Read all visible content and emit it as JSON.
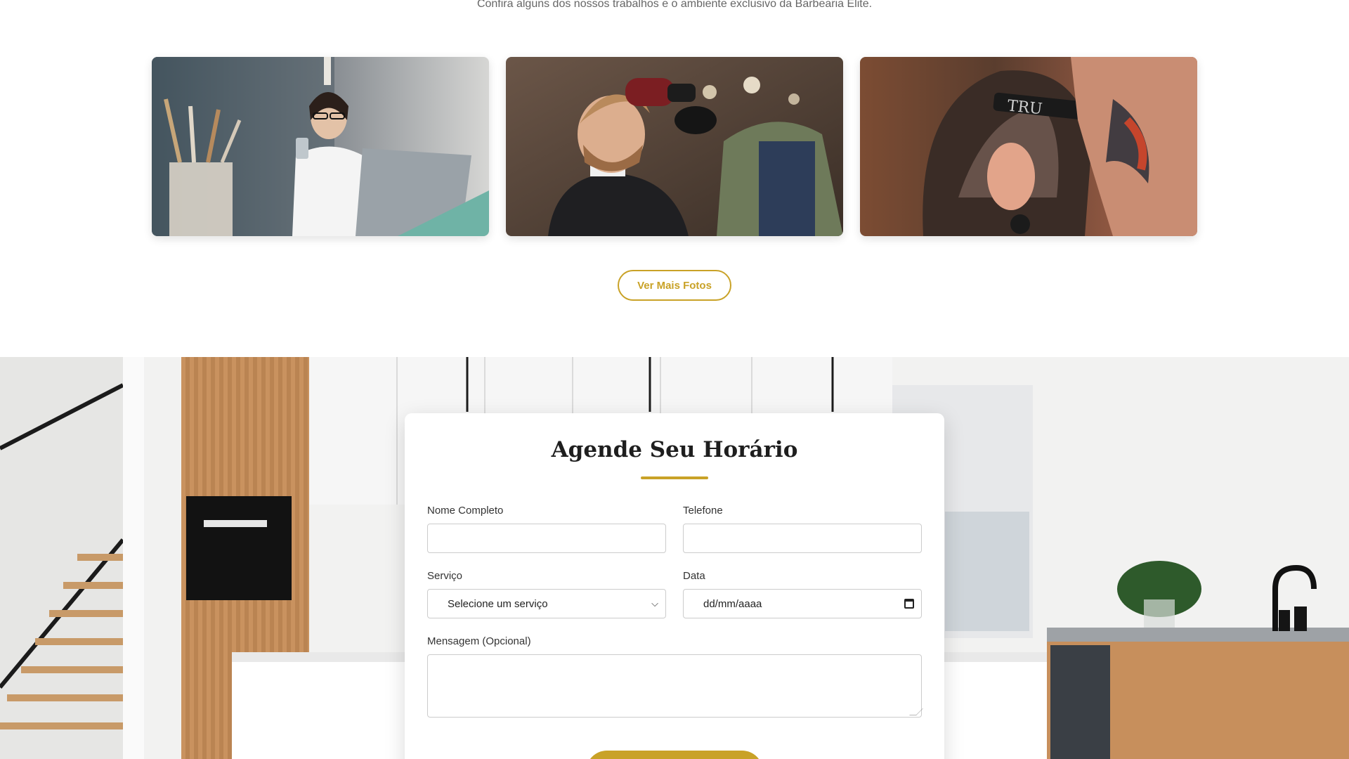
{
  "gallery": {
    "subtitle": "Confira alguns dos nossos trabalhos e o ambiente exclusivo da Barbearia Elite.",
    "more_button_label": "Ver Mais Fotos",
    "photo_text": "TRU"
  },
  "booking": {
    "title": "Agende Seu Horário",
    "fields": {
      "name_label": "Nome Completo",
      "name_value": "",
      "phone_label": "Telefone",
      "phone_value": "",
      "service_label": "Serviço",
      "service_selected": "Selecione um serviço",
      "date_label": "Data",
      "date_value": "dd/mm/aaaa",
      "message_label": "Mensagem (Opcional)",
      "message_value": ""
    }
  },
  "colors": {
    "accent": "#c9a227",
    "heading": "#1e1e1e",
    "text": "#333333"
  }
}
